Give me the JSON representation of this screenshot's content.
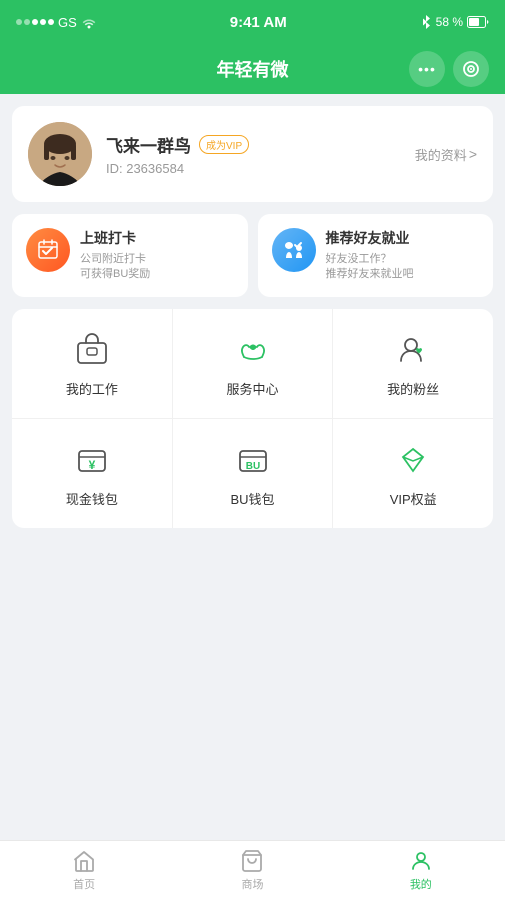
{
  "statusBar": {
    "time": "9:41 AM",
    "carrier": "GS",
    "battery": "58 %",
    "bluetooth": "♦"
  },
  "header": {
    "title": "年轻有微",
    "moreLabel": "···",
    "scanLabel": "⊙"
  },
  "profile": {
    "name": "飞来一群鸟",
    "vipLabel": "成为VIP",
    "idLabel": "ID: 23636584",
    "actionLabel": "我的资料",
    "chevron": ">"
  },
  "banners": [
    {
      "title": "上班打卡",
      "desc": "公司附近打卡\n可获得BU奖励"
    },
    {
      "title": "推荐好友就业",
      "desc": "好友没工作？\n推荐好友来就业吧"
    }
  ],
  "gridRow1": [
    {
      "label": "我的工作"
    },
    {
      "label": "服务中心"
    },
    {
      "label": "我的粉丝"
    }
  ],
  "gridRow2": [
    {
      "label": "现金钱包"
    },
    {
      "label": "BU钱包"
    },
    {
      "label": "VIP权益"
    }
  ],
  "tabs": [
    {
      "label": "首页",
      "active": false
    },
    {
      "label": "商场",
      "active": false
    },
    {
      "label": "我的",
      "active": true
    }
  ],
  "colors": {
    "primary": "#2cc163",
    "orange": "#ff7043",
    "blue": "#42a5f5"
  }
}
